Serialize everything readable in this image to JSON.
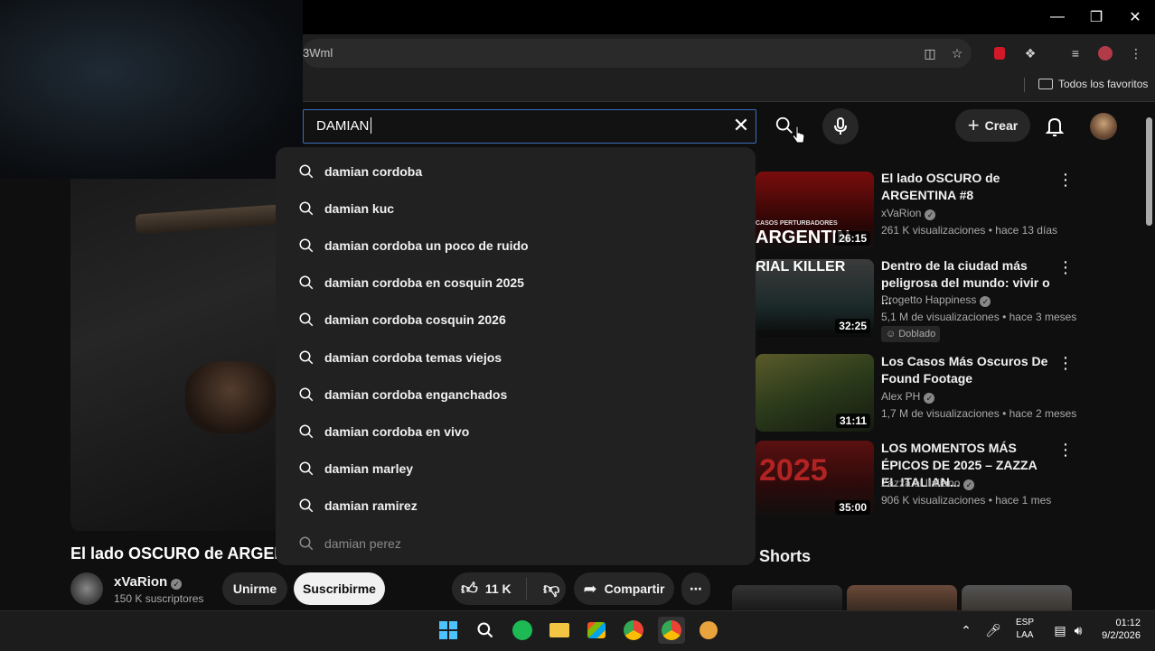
{
  "browser": {
    "url_fragment": "3Wml",
    "bookmarks_label": "Todos los favoritos"
  },
  "search": {
    "query": "DAMIAN",
    "suggestions": [
      "damian cordoba",
      "damian kuc",
      "damian cordoba un poco de ruido",
      "damian cordoba en cosquin 2025",
      "damian cordoba cosquin 2026",
      "damian cordoba temas viejos",
      "damian cordoba enganchados",
      "damian cordoba en vivo",
      "damian marley",
      "damian ramirez",
      "damian perez"
    ]
  },
  "header": {
    "create_label": "Crear"
  },
  "video": {
    "title": "El lado OSCURO de ARGENT",
    "channel": "xVaRion",
    "subscribers": "150 K suscriptores",
    "join_label": "Unirme",
    "subscribe_label": "Suscribirme",
    "likes": "11 K",
    "share_label": "Compartir"
  },
  "related": [
    {
      "title": "El lado OSCURO de ARGENTINA #8",
      "channel": "xVaRion",
      "meta": "261 K visualizaciones • hace 13 días",
      "duration": "26:15",
      "thumb_text_top": "CASOS PERTURBADORES",
      "thumb_text_big": "ARGENTIN"
    },
    {
      "title": "Dentro de la ciudad más peligrosa del mundo: vivir o ...",
      "channel": "Progetto Happiness",
      "meta": "5,1 M de visualizaciones • hace 3 meses",
      "duration": "32:25",
      "badge": "Doblado",
      "thumb_text_big": "RIAL KILLER"
    },
    {
      "title": "Los Casos Más Oscuros De Found Footage",
      "channel": "Alex PH",
      "meta": "1,7 M de visualizaciones • hace 2 meses",
      "duration": "31:11"
    },
    {
      "title": "LOS MOMENTOS MÁS ÉPICOS DE 2025 – ZAZZA EL ITALIAN...",
      "channel": "Zazza el Italiano",
      "meta": "906 K visualizaciones • hace 1 mes",
      "duration": "35:00",
      "thumb_text_big": "2025"
    }
  ],
  "shorts_label": "Shorts",
  "taskbar": {
    "lang_top": "ESP",
    "lang_bottom": "LAA",
    "time": "01:12",
    "date": "9/2/2026"
  },
  "colors": {
    "background": "#0f0f0f",
    "search_focus": "#3c6cbf",
    "spotify": "#1db954"
  }
}
